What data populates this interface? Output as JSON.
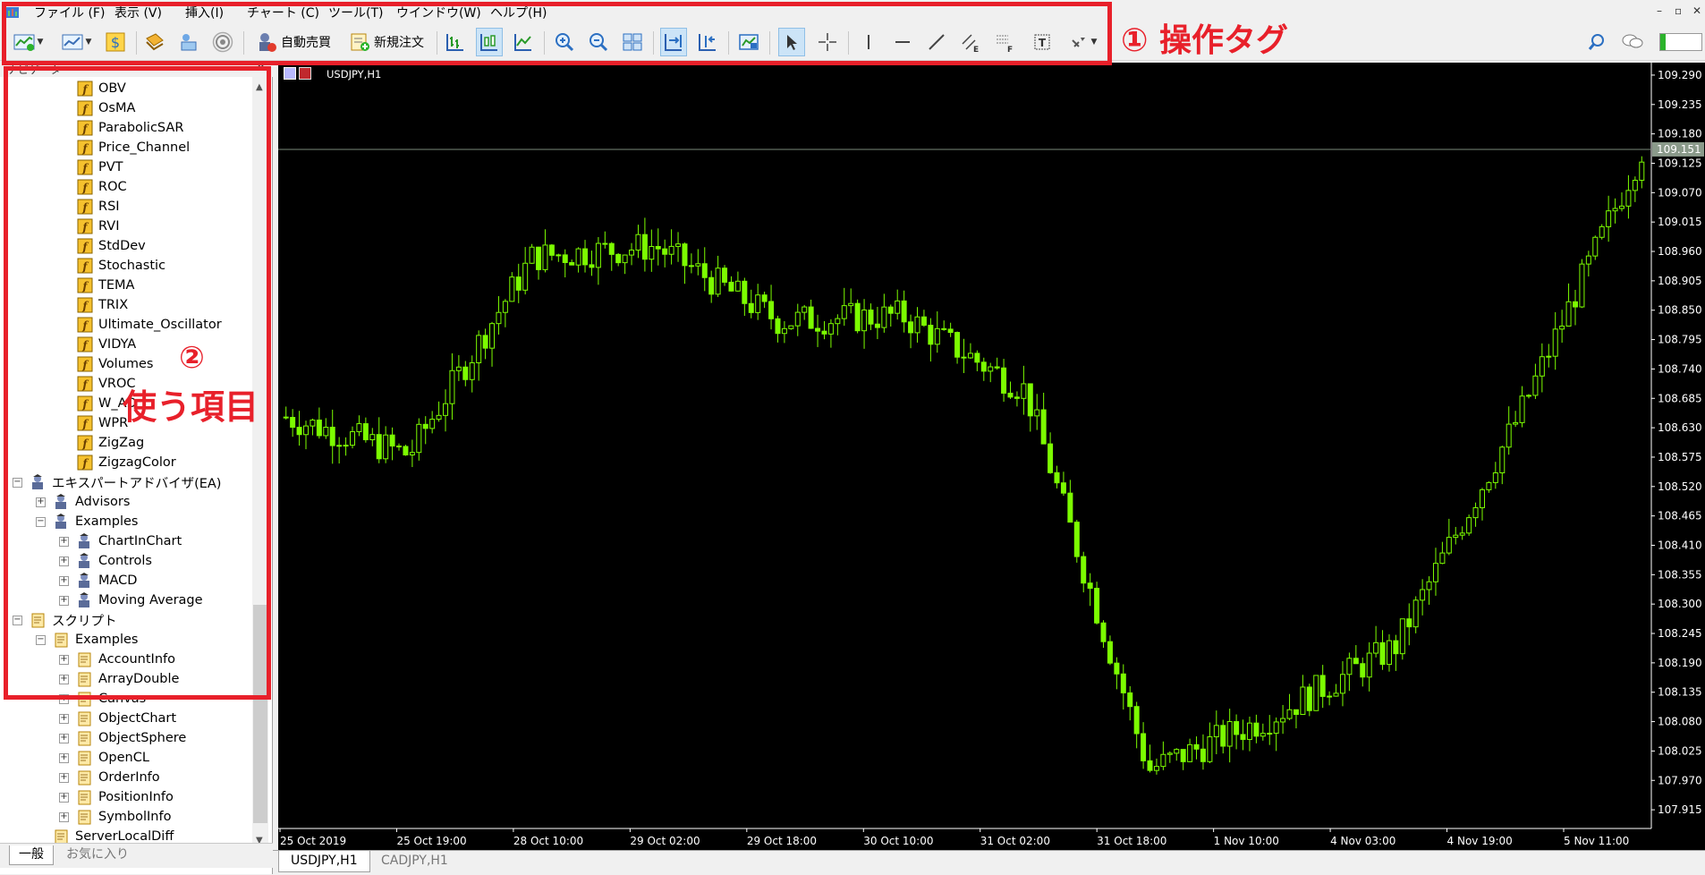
{
  "menubar": {
    "items": [
      "ファイル (F)",
      "表示 (V)",
      "挿入(I)",
      "チャート (C)",
      "ツール(T)",
      "ウインドウ(W)",
      "ヘルプ(H)"
    ]
  },
  "toolbar": {
    "auto_trade_label": "自動売買",
    "new_order_label": "新規注文"
  },
  "annotations": {
    "label_1": "① 操作タグ",
    "label_2_num": "②",
    "label_2_text": "使う項目",
    "color": "#e8202a"
  },
  "navigator": {
    "title": "ナビゲータ",
    "tree": [
      {
        "label": "OBV",
        "level": 3,
        "icon": "indicator-icon"
      },
      {
        "label": "OsMA",
        "level": 3,
        "icon": "indicator-icon"
      },
      {
        "label": "ParabolicSAR",
        "level": 3,
        "icon": "indicator-icon"
      },
      {
        "label": "Price_Channel",
        "level": 3,
        "icon": "indicator-icon"
      },
      {
        "label": "PVT",
        "level": 3,
        "icon": "indicator-icon"
      },
      {
        "label": "ROC",
        "level": 3,
        "icon": "indicator-icon"
      },
      {
        "label": "RSI",
        "level": 3,
        "icon": "indicator-icon"
      },
      {
        "label": "RVI",
        "level": 3,
        "icon": "indicator-icon"
      },
      {
        "label": "StdDev",
        "level": 3,
        "icon": "indicator-icon"
      },
      {
        "label": "Stochastic",
        "level": 3,
        "icon": "indicator-icon"
      },
      {
        "label": "TEMA",
        "level": 3,
        "icon": "indicator-icon"
      },
      {
        "label": "TRIX",
        "level": 3,
        "icon": "indicator-icon"
      },
      {
        "label": "Ultimate_Oscillator",
        "level": 3,
        "icon": "indicator-icon"
      },
      {
        "label": "VIDYA",
        "level": 3,
        "icon": "indicator-icon"
      },
      {
        "label": "Volumes",
        "level": 3,
        "icon": "indicator-icon"
      },
      {
        "label": "VROC",
        "level": 3,
        "icon": "indicator-icon"
      },
      {
        "label": "W_AD",
        "level": 3,
        "icon": "indicator-icon"
      },
      {
        "label": "WPR",
        "level": 3,
        "icon": "indicator-icon"
      },
      {
        "label": "ZigZag",
        "level": 3,
        "icon": "indicator-icon"
      },
      {
        "label": "ZigzagColor",
        "level": 3,
        "icon": "indicator-icon"
      },
      {
        "label": "エキスパートアドバイザ(EA)",
        "level": 1,
        "icon": "expert-icon",
        "expander": "−"
      },
      {
        "label": "Advisors",
        "level": 2,
        "icon": "expert-icon",
        "expander": "+"
      },
      {
        "label": "Examples",
        "level": 2,
        "icon": "expert-icon",
        "expander": "−"
      },
      {
        "label": "ChartInChart",
        "level": 3,
        "icon": "expert-icon",
        "expander": "+"
      },
      {
        "label": "Controls",
        "level": 3,
        "icon": "expert-icon",
        "expander": "+"
      },
      {
        "label": "MACD",
        "level": 3,
        "icon": "expert-icon",
        "expander": "+"
      },
      {
        "label": "Moving Average",
        "level": 3,
        "icon": "expert-icon",
        "expander": "+"
      },
      {
        "label": "スクリプト",
        "level": 1,
        "icon": "script-icon",
        "expander": "−"
      },
      {
        "label": "Examples",
        "level": 2,
        "icon": "script-icon",
        "expander": "−"
      },
      {
        "label": "AccountInfo",
        "level": 3,
        "icon": "script-icon",
        "expander": "+"
      },
      {
        "label": "ArrayDouble",
        "level": 3,
        "icon": "script-icon",
        "expander": "+"
      },
      {
        "label": "Canvas",
        "level": 3,
        "icon": "script-icon",
        "expander": "+"
      },
      {
        "label": "ObjectChart",
        "level": 3,
        "icon": "script-icon",
        "expander": "+"
      },
      {
        "label": "ObjectSphere",
        "level": 3,
        "icon": "script-icon",
        "expander": "+"
      },
      {
        "label": "OpenCL",
        "level": 3,
        "icon": "script-icon",
        "expander": "+"
      },
      {
        "label": "OrderInfo",
        "level": 3,
        "icon": "script-icon",
        "expander": "+"
      },
      {
        "label": "PositionInfo",
        "level": 3,
        "icon": "script-icon",
        "expander": "+"
      },
      {
        "label": "SymbolInfo",
        "level": 3,
        "icon": "script-icon",
        "expander": "+"
      },
      {
        "label": "ServerLocalDiff",
        "level": 2,
        "icon": "script-icon"
      }
    ],
    "tabs": [
      "一般",
      "お気に入り"
    ]
  },
  "chart": {
    "symbol_label": "USDJPY,H1",
    "current_price": "109.151",
    "price_ticks": [
      "109.290",
      "109.235",
      "109.180",
      "109.125",
      "109.070",
      "109.015",
      "108.960",
      "108.905",
      "108.850",
      "108.795",
      "108.740",
      "108.685",
      "108.630",
      "108.575",
      "108.520",
      "108.465",
      "108.410",
      "108.355",
      "108.300",
      "108.245",
      "108.190",
      "108.135",
      "108.080",
      "108.025",
      "107.970",
      "107.915"
    ],
    "time_ticks": [
      "25 Oct 2019",
      "25 Oct 19:00",
      "28 Oct 10:00",
      "29 Oct 02:00",
      "29 Oct 18:00",
      "30 Oct 10:00",
      "31 Oct 02:00",
      "31 Oct 18:00",
      "1 Nov 10:00",
      "4 Nov 03:00",
      "4 Nov 19:00",
      "5 Nov 11:00"
    ],
    "colors": {
      "background": "#000000",
      "candle": "#7cfc00",
      "axis_text": "#ffffff"
    }
  },
  "chart_tabs": [
    "USDJPY,H1",
    "CADJPY,H1"
  ],
  "chart_data": {
    "type": "candlestick",
    "series": [
      {
        "name": "USDJPY,H1"
      }
    ],
    "x": [
      "25 Oct 2019",
      "25 Oct 19:00",
      "28 Oct 10:00",
      "29 Oct 02:00",
      "29 Oct 18:00",
      "30 Oct 10:00",
      "31 Oct 02:00",
      "31 Oct 18:00",
      "1 Nov 10:00",
      "4 Nov 03:00",
      "4 Nov 19:00",
      "5 Nov 11:00"
    ],
    "close": [
      108.65,
      108.58,
      108.95,
      108.97,
      108.83,
      108.84,
      108.7,
      107.99,
      108.09,
      108.22,
      108.65,
      109.15
    ],
    "ylim": [
      107.88,
      109.31
    ],
    "grid": false
  }
}
